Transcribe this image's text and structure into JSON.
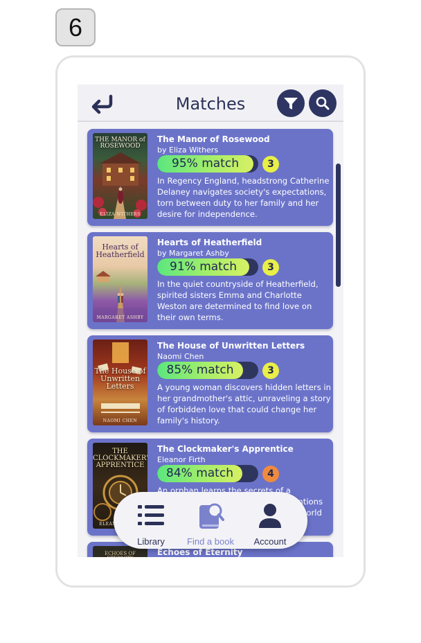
{
  "step_number": "6",
  "header": {
    "title": "Matches",
    "back_icon": "return-arrow-icon",
    "filter_icon": "funnel-icon",
    "search_icon": "magnifier-icon"
  },
  "books": [
    {
      "title": "The Manor of Rosewood",
      "author": "by Eliza Withers",
      "match_label": "95% match",
      "match_percent": 95,
      "count": "3",
      "badge_color": "#e9ef47",
      "description": "In Regency England, headstrong Catherine Delaney navigates society's expectations, torn between duty to her family and her desire for independence.",
      "cover_title": "THE MANOR of ROSEWOOD",
      "cover_author": "ELIZA WITHERS"
    },
    {
      "title": "Hearts of Heatherfield",
      "author": "by Margaret Ashby",
      "match_label": "91% match",
      "match_percent": 91,
      "count": "3",
      "badge_color": "#e9ef47",
      "description": "In the quiet countryside of Heatherfield, spirited sisters Emma and Charlotte Weston are determined to find love on their own terms.",
      "cover_title": "Hearts of Heatherfield",
      "cover_author": "MARGARET ASHBY"
    },
    {
      "title": "The House of Unwritten Letters",
      "author": "Naomi Chen",
      "match_label": "85% match",
      "match_percent": 85,
      "count": "3",
      "badge_color": "#e9ef47",
      "description": "A young woman discovers hidden letters in her grandmother's attic, unraveling a story of forbidden love that could change her family's history.",
      "cover_title": "The House of Unwritten Letters",
      "cover_author": "NAOMI CHEN"
    },
    {
      "title": "The Clockmaker's Apprentice",
      "author": "Eleanor Firth",
      "match_label": "84% match",
      "match_percent": 84,
      "count": "4",
      "badge_color": "#f08a3e",
      "description": "An orphan learns the secrets of a clockmaker whose mysterious inventions hold the key to a hidden, beguiling world of alchemy.",
      "cover_title": "THE CLOCKMAKER'S APPRENTICE",
      "cover_author": "ELEANOR FIRTH"
    },
    {
      "title": "Echoes of Eternity",
      "cover_title": "ECHOES OF ETERNITY"
    }
  ],
  "nav": {
    "library_label": "Library",
    "find_label": "Find a book",
    "account_label": "Account",
    "library_icon": "list-icon",
    "find_icon": "book-search-icon",
    "account_icon": "user-icon"
  },
  "colors": {
    "card_bg": "#6b73c9",
    "accent_dark": "#2e3563",
    "match_green": "#5ce67f",
    "active_nav": "#7b82cc"
  }
}
